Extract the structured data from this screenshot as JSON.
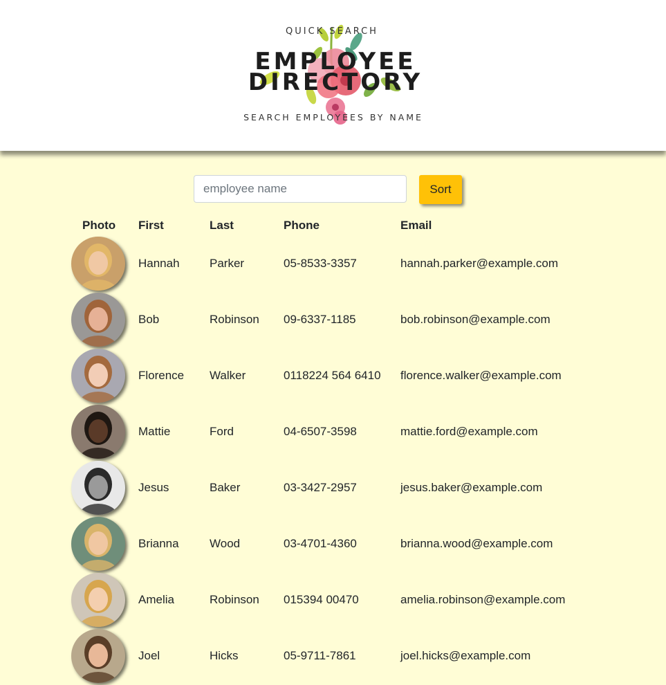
{
  "header": {
    "logo_top": "QUICK SEARCH",
    "logo_line1": "EMPLOYEE",
    "logo_line2": "DIRECTORY",
    "logo_bottom": "SEARCH EMPLOYEES BY NAME"
  },
  "search": {
    "placeholder": "employee name",
    "value": "",
    "sort_label": "Sort"
  },
  "table": {
    "columns": [
      "Photo",
      "First",
      "Last",
      "Phone",
      "Email"
    ],
    "rows": [
      {
        "first": "Hannah",
        "last": "Parker",
        "phone": "05-8533-3357",
        "email": "hannah.parker@example.com",
        "photo": "person-avatar"
      },
      {
        "first": "Bob",
        "last": "Robinson",
        "phone": "09-6337-1185",
        "email": "bob.robinson@example.com",
        "photo": "person-avatar"
      },
      {
        "first": "Florence",
        "last": "Walker",
        "phone": "0118224 564 6410",
        "email": "florence.walker@example.com",
        "photo": "person-avatar"
      },
      {
        "first": "Mattie",
        "last": "Ford",
        "phone": "04-6507-3598",
        "email": "mattie.ford@example.com",
        "photo": "person-avatar"
      },
      {
        "first": "Jesus",
        "last": "Baker",
        "phone": "03-3427-2957",
        "email": "jesus.baker@example.com",
        "photo": "person-avatar"
      },
      {
        "first": "Brianna",
        "last": "Wood",
        "phone": "03-4701-4360",
        "email": "brianna.wood@example.com",
        "photo": "person-avatar"
      },
      {
        "first": "Amelia",
        "last": "Robinson",
        "phone": "015394 00470",
        "email": "amelia.robinson@example.com",
        "photo": "person-avatar"
      },
      {
        "first": "Joel",
        "last": "Hicks",
        "phone": "05-9711-7861",
        "email": "joel.hicks@example.com",
        "photo": "person-avatar"
      }
    ]
  },
  "colors": {
    "page_bg": "#fffdd6",
    "header_bg": "#ffffff",
    "sort_button": "#ffc107"
  }
}
